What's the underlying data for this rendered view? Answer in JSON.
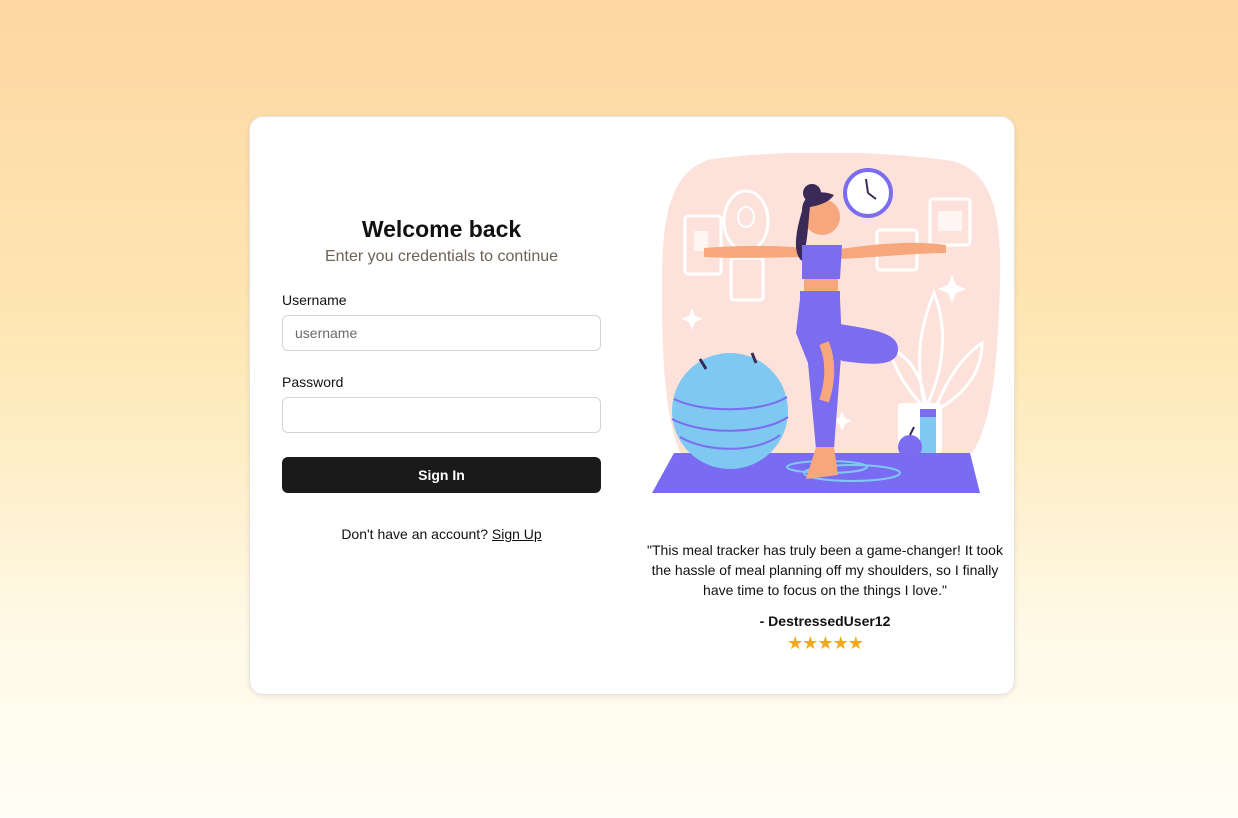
{
  "login": {
    "title": "Welcome back",
    "subtitle": "Enter you credentials to continue",
    "username_label": "Username",
    "username_placeholder": "username",
    "username_value": "",
    "password_label": "Password",
    "password_value": "",
    "signin_label": "Sign In",
    "signup_prompt": "Don't have an account?",
    "signup_link": "Sign Up"
  },
  "testimonial": {
    "quote": "\"This meal tracker has truly been a game-changer! It took the hassle of meal planning off my shoulders, so I finally have time to focus on the things I love.\"",
    "author": "- DestressedUser12",
    "stars": [
      "★",
      "★",
      "★",
      "★",
      "★"
    ],
    "star_color": "#f0a81c"
  },
  "illustration": {
    "icon": "yoga-woman-illustration",
    "colors": {
      "backdrop": "#fde2db",
      "outfit": "#7b6cf0",
      "ball": "#7ec8f2",
      "mat": "#7a6cf2",
      "skin": "#f6a77b"
    }
  },
  "colors": {
    "button_bg": "#1a1a1a",
    "page_gradient_top": "#fed7a0",
    "page_gradient_bottom": "#fffdf5"
  }
}
